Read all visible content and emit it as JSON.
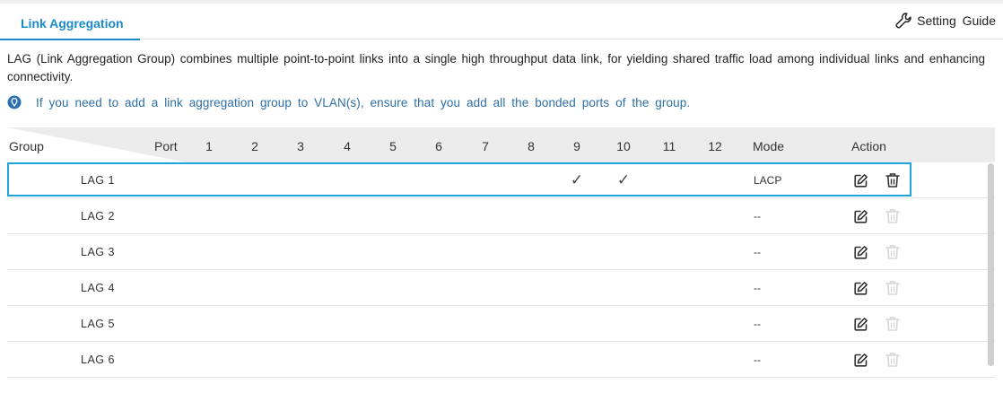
{
  "tabs": {
    "active_label": "Link Aggregation"
  },
  "guide": {
    "label": "Setting Guide"
  },
  "description": "LAG (Link Aggregation Group) combines multiple point-to-point links into a single high throughput data link, for yielding shared traffic load among individual links and enhancing connectivity.",
  "note": "If you need to add a link aggregation group to VLAN(s), ensure that you add all the bonded ports of the group.",
  "table": {
    "headers": {
      "group": "Group",
      "port": "Port",
      "ports": [
        "1",
        "2",
        "3",
        "4",
        "5",
        "6",
        "7",
        "8",
        "9",
        "10",
        "11",
        "12"
      ],
      "mode": "Mode",
      "action": "Action"
    },
    "rows": [
      {
        "name": "LAG  1",
        "ports": [
          9,
          10
        ],
        "mode": "LACP",
        "delete_enabled": true,
        "selected": true
      },
      {
        "name": "LAG  2",
        "ports": [],
        "mode": "--",
        "delete_enabled": false,
        "selected": false
      },
      {
        "name": "LAG  3",
        "ports": [],
        "mode": "--",
        "delete_enabled": false,
        "selected": false
      },
      {
        "name": "LAG  4",
        "ports": [],
        "mode": "--",
        "delete_enabled": false,
        "selected": false
      },
      {
        "name": "LAG  5",
        "ports": [],
        "mode": "--",
        "delete_enabled": false,
        "selected": false
      },
      {
        "name": "LAG  6",
        "ports": [],
        "mode": "--",
        "delete_enabled": false,
        "selected": false
      }
    ],
    "check_glyph": "✓"
  },
  "icons": {
    "guide": "wrench-icon",
    "note": "info-pin-icon",
    "edit": "edit-icon",
    "delete": "trash-icon"
  },
  "colors": {
    "accent": "#1a8bc9",
    "selection_outline": "#1ea5e0",
    "note_text": "#2e6ea6",
    "header_bg": "#ececec"
  }
}
